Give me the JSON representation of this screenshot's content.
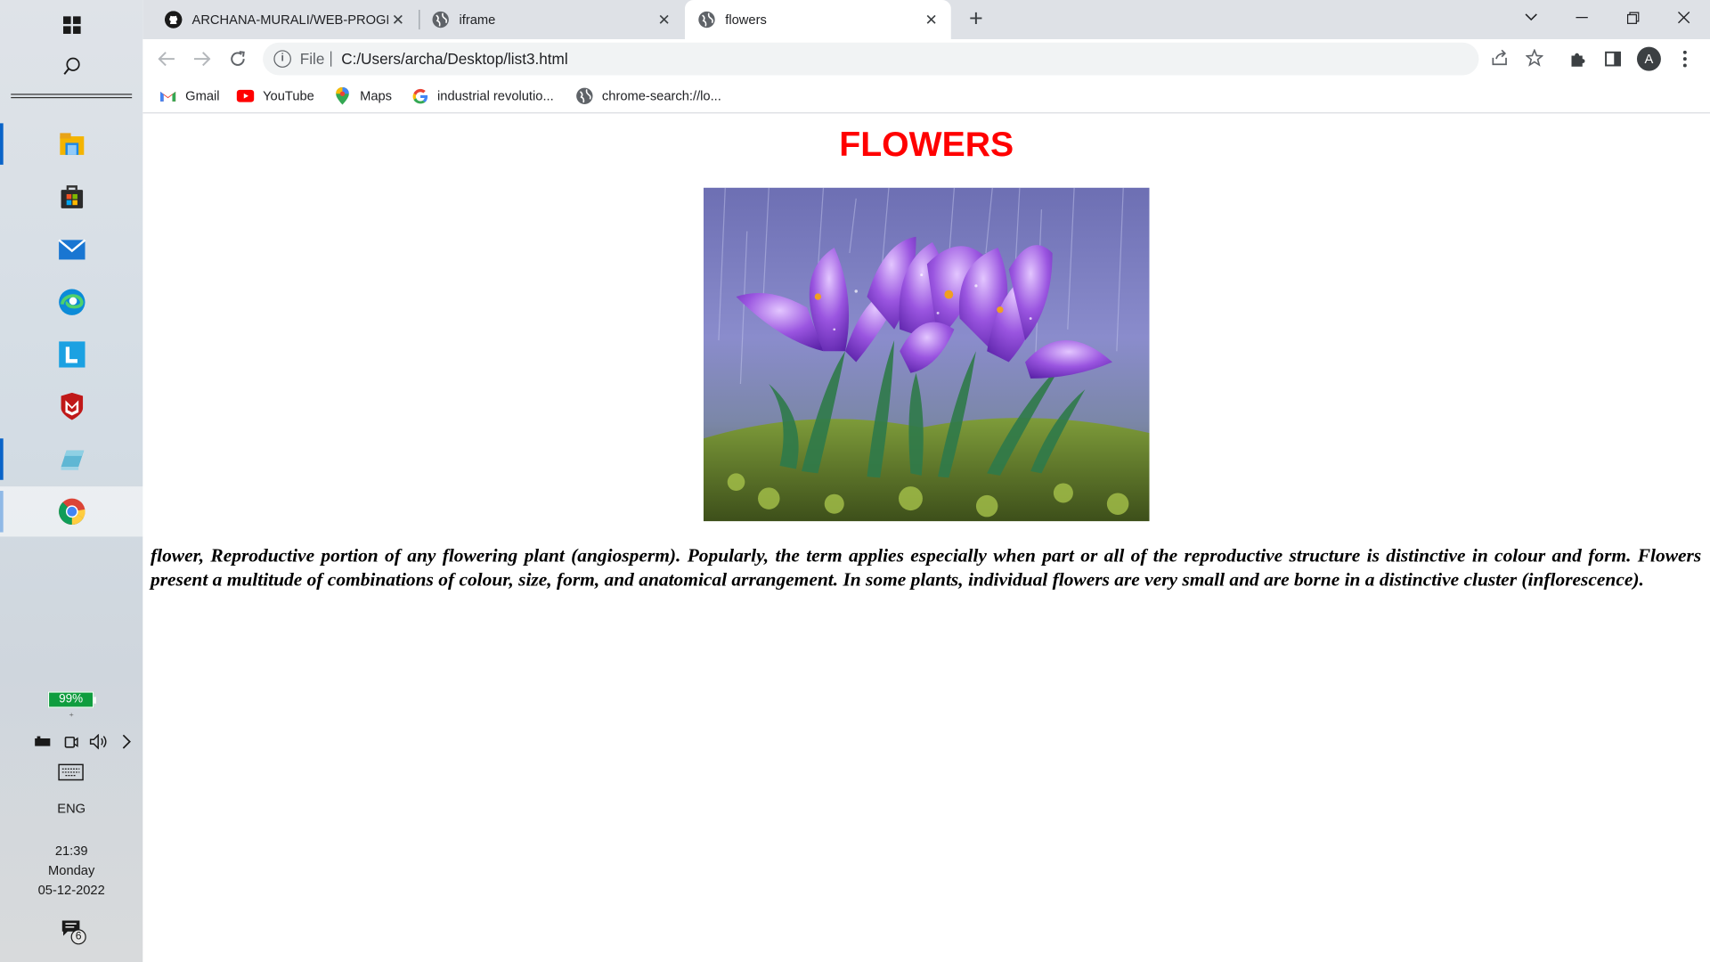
{
  "taskbar": {
    "battery": "99%",
    "language": "ENG",
    "time": "21:39",
    "day": "Monday",
    "date": "05-12-2022",
    "notifications_count": "6",
    "apps": [
      "file-explorer-icon",
      "store-icon",
      "mail-icon",
      "edge-icon",
      "launcher-l-icon",
      "mcafee-icon",
      "app-book-icon",
      "chrome-icon"
    ]
  },
  "tabs": [
    {
      "title": "ARCHANA-MURALI/WEB-PROGR",
      "icon": "github-icon"
    },
    {
      "title": "iframe",
      "icon": "globe-icon"
    },
    {
      "title": "flowers",
      "icon": "globe-icon",
      "active": true
    }
  ],
  "address_bar": {
    "scheme_label": "File",
    "url": "C:/Users/archa/Desktop/list3.html"
  },
  "bookmarks": [
    {
      "label": "Gmail",
      "icon": "gmail-icon"
    },
    {
      "label": "YouTube",
      "icon": "youtube-icon"
    },
    {
      "label": "Maps",
      "icon": "maps-icon"
    },
    {
      "label": "industrial revolutio...",
      "icon": "google-icon"
    },
    {
      "label": "chrome-search://lo...",
      "icon": "globe-icon"
    }
  ],
  "profile_initial": "A",
  "page": {
    "heading": "FLOWERS",
    "heading_color": "#ff0000",
    "image_alt": "purple crocus flowers in rain",
    "paragraph": "flower, Reproductive portion of any flowering plant (angiosperm). Popularly, the term applies especially when part or all of the reproductive structure is distinctive in colour and form. Flowers present a multitude of combinations of colour, size, form, and anatomical arrangement. In some plants, individual flowers are very small and are borne in a distinctive cluster (inflorescence)."
  }
}
